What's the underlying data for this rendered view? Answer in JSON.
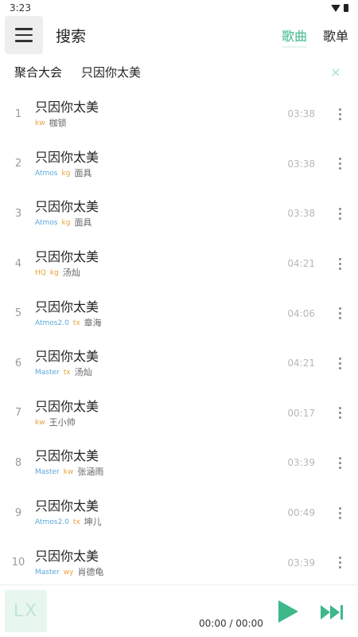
{
  "status": {
    "time": "3:23"
  },
  "header": {
    "title": "搜索",
    "tabs": [
      {
        "label": "歌曲",
        "active": true
      },
      {
        "label": "歌单",
        "active": false
      }
    ]
  },
  "search": {
    "source": "聚合大会",
    "query": "只因你太美",
    "close": "×"
  },
  "songs": [
    {
      "index": "1",
      "title": "只因你太美",
      "quality": "",
      "source": "kw",
      "singer": "枷锁",
      "duration": "03:38"
    },
    {
      "index": "2",
      "title": "只因你太美",
      "quality": "Atmos",
      "source": "kg",
      "singer": "面具",
      "duration": "03:38"
    },
    {
      "index": "3",
      "title": "只因你太美",
      "quality": "Atmos",
      "source": "kg",
      "singer": "面具",
      "duration": "03:38"
    },
    {
      "index": "4",
      "title": "只因你太美",
      "quality": "HQ",
      "source": "kg",
      "singer": "汤灿",
      "duration": "04:21"
    },
    {
      "index": "5",
      "title": "只因你太美",
      "quality": "Atmos2.0",
      "source": "tx",
      "singer": "章海",
      "duration": "04:06"
    },
    {
      "index": "6",
      "title": "只因你太美",
      "quality": "Master",
      "source": "tx",
      "singer": "汤灿",
      "duration": "04:21"
    },
    {
      "index": "7",
      "title": "只因你太美",
      "quality": "",
      "source": "kw",
      "singer": "王小帅",
      "duration": "00:17"
    },
    {
      "index": "8",
      "title": "只因你太美",
      "quality": "Master",
      "source": "kw",
      "singer": "张涵雨",
      "duration": "03:39"
    },
    {
      "index": "9",
      "title": "只因你太美",
      "quality": "Atmos2.0",
      "source": "tx",
      "singer": "坤儿",
      "duration": "00:49"
    },
    {
      "index": "10",
      "title": "只因你太美",
      "quality": "Master",
      "source": "wy",
      "singer": "肖德龟",
      "duration": "03:39"
    }
  ],
  "player": {
    "cover_text": "LX",
    "time": "00:00 / 00:00"
  },
  "colors": {
    "accent": "#3cb88a",
    "source": "#e8a23a",
    "quality": "#5aa8d8"
  }
}
